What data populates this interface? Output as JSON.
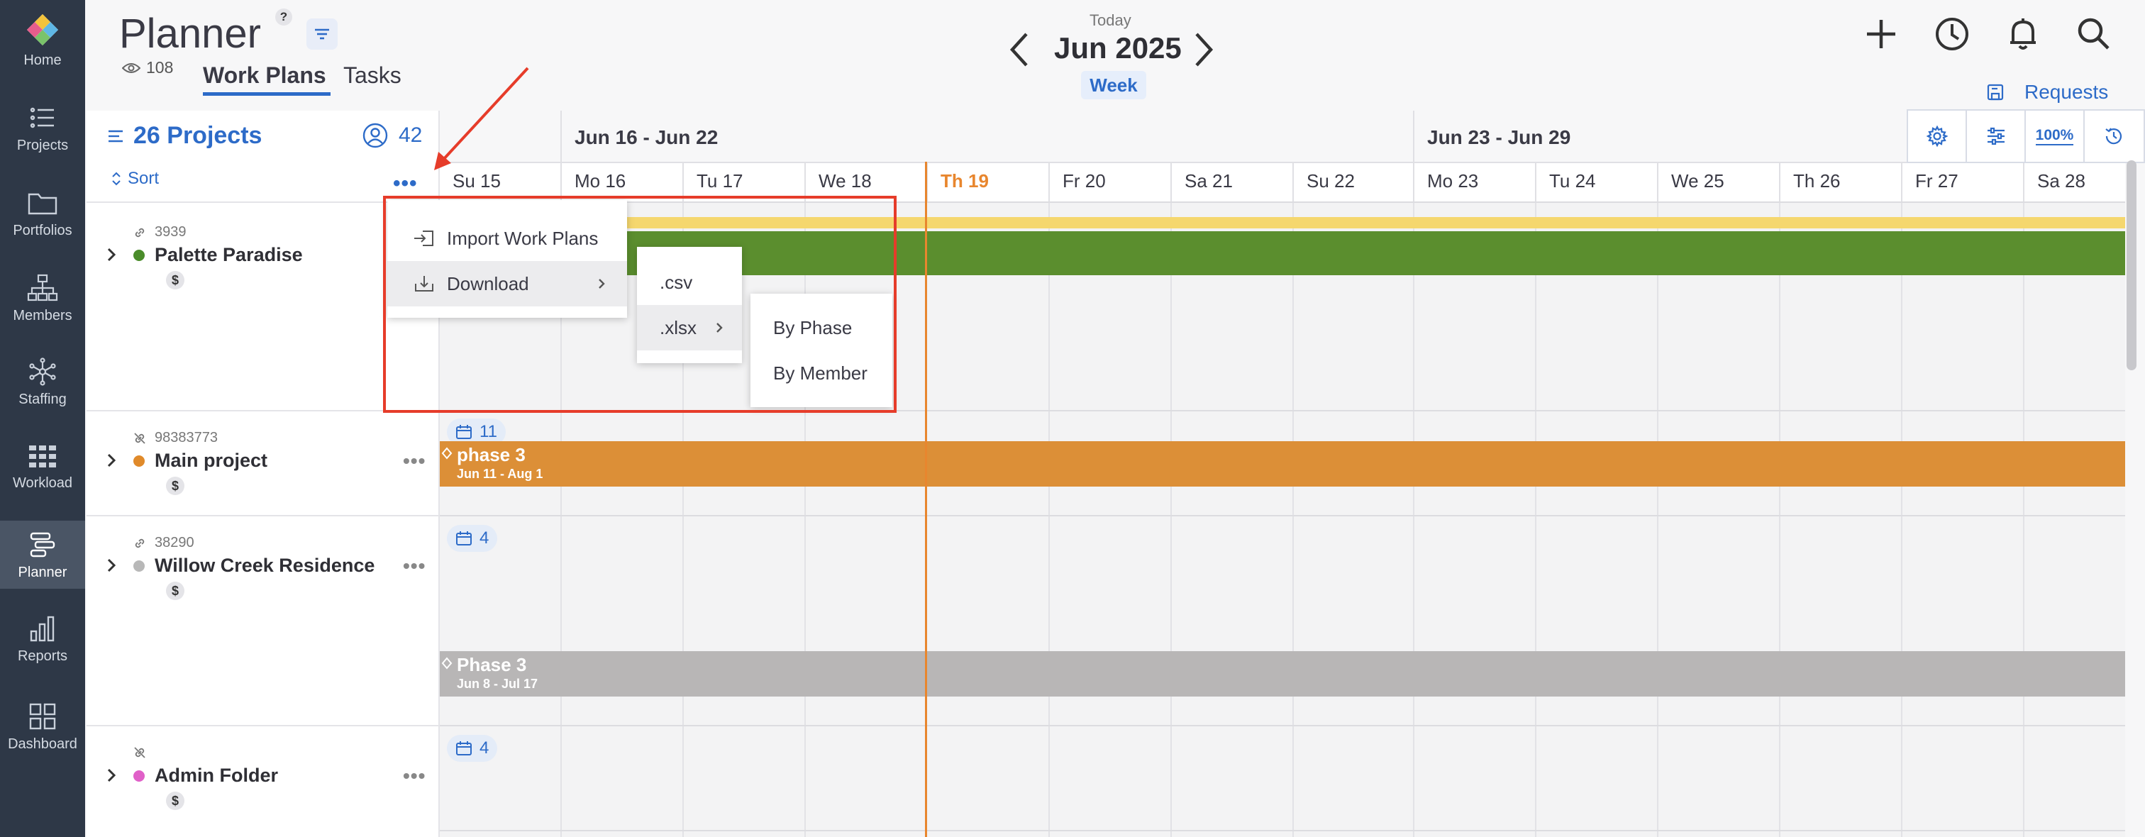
{
  "sidebar": {
    "items": [
      {
        "label": "Home",
        "icon": "home-logo-icon"
      },
      {
        "label": "Projects",
        "icon": "list-icon"
      },
      {
        "label": "Portfolios",
        "icon": "folder-icon"
      },
      {
        "label": "Members",
        "icon": "org-chart-icon"
      },
      {
        "label": "Staffing",
        "icon": "network-icon"
      },
      {
        "label": "Workload",
        "icon": "grid-icon"
      },
      {
        "label": "Planner",
        "icon": "planner-icon"
      },
      {
        "label": "Reports",
        "icon": "bar-chart-icon"
      },
      {
        "label": "Dashboard",
        "icon": "dashboard-icon"
      }
    ]
  },
  "header": {
    "title": "Planner",
    "help": "?",
    "viewers": "108",
    "tabs": [
      "Work Plans",
      "Tasks"
    ],
    "today_label": "Today",
    "month": "Jun 2025",
    "view_mode": "Week",
    "requests_label": "Requests"
  },
  "left_panel": {
    "projects_label": "26 Projects",
    "members_count": "42",
    "sort_label": "Sort",
    "more": "•••"
  },
  "projects": [
    {
      "id": "3939",
      "name": "Palette Paradise",
      "dot_color": "#4a8c2a",
      "dollar": "$"
    },
    {
      "id": "98383773",
      "name": "Main project",
      "dot_color": "#e08a2a",
      "dollar": "$"
    },
    {
      "id": "38290",
      "name": "Willow Creek Residence",
      "dot_color": "#b8b8b8",
      "dollar": "$"
    },
    {
      "id": "",
      "name": "Admin Folder",
      "dot_color": "#e060c8",
      "dollar": "$"
    }
  ],
  "calendar": {
    "weeks": [
      "Jun 16 - Jun 22",
      "Jun 23 - Jun 29"
    ],
    "days": [
      "Su 15",
      "Mo 16",
      "Tu 17",
      "We 18",
      "Th 19",
      "Fr 20",
      "Sa 21",
      "Su 22",
      "Mo 23",
      "Tu 24",
      "We 25",
      "Th 26",
      "Fr 27",
      "Sa 28"
    ],
    "today": "Th 19"
  },
  "bars": {
    "main_phase": {
      "title": "phase 3",
      "dates": "Jun 11 - Aug 1",
      "color": "#dc8f37"
    },
    "willow_phase": {
      "title": "Phase 3",
      "dates": "Jun 8 - Jul 17",
      "color": "#b8b6b6"
    }
  },
  "badges": [
    "11",
    "4",
    "4"
  ],
  "toolbar": {
    "zoom": "100%"
  },
  "menu": {
    "import_label": "Import Work Plans",
    "download_label": "Download",
    "csv_label": ".csv",
    "xlsx_label": ".xlsx",
    "by_phase_label": "By Phase",
    "by_member_label": "By Member"
  },
  "colors": {
    "accent": "#2d6bc8",
    "sidebar": "#2e3847",
    "today": "#e8862e",
    "highlight": "#e63c2a"
  }
}
